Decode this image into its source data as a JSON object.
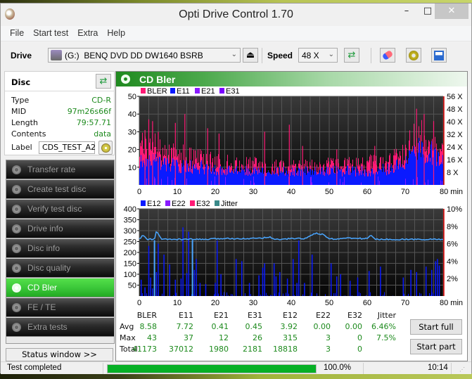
{
  "window": {
    "title": "Opti Drive Control 1.70",
    "minimize_glyph": "–",
    "maximize_glyph": "□",
    "close_glyph": "✕"
  },
  "menu": [
    "File",
    "Start test",
    "Extra",
    "Help"
  ],
  "toolbar": {
    "drive_label": "Drive",
    "drive_value": "(G:)  BENQ DVD DD DW1640 BSRB",
    "eject_glyph": "⏏",
    "speed_label": "Speed",
    "speed_value": "48 X",
    "chevron_glyph": "⌵"
  },
  "disc": {
    "title": "Disc",
    "fields": [
      {
        "key": "Type",
        "value": "CD-R"
      },
      {
        "key": "MID",
        "value": "97m26s66f"
      },
      {
        "key": "Length",
        "value": "79:57.71"
      },
      {
        "key": "Contents",
        "value": "data"
      }
    ],
    "label_key": "Label",
    "label_value": "CDS_TEST_A2"
  },
  "nav": [
    {
      "label": "Transfer rate",
      "active": false
    },
    {
      "label": "Create test disc",
      "active": false
    },
    {
      "label": "Verify test disc",
      "active": false
    },
    {
      "label": "Drive info",
      "active": false
    },
    {
      "label": "Disc info",
      "active": false
    },
    {
      "label": "Disc quality",
      "active": false
    },
    {
      "label": "CD Bler",
      "active": true
    },
    {
      "label": "FE / TE",
      "active": false
    },
    {
      "label": "Extra tests",
      "active": false
    }
  ],
  "status_window_label": "Status window >>",
  "panel_title": "CD Bler",
  "colors": {
    "bler": "#ff1a75",
    "e11": "#0a1aff",
    "e21": "#8a1aff",
    "e31": "#7a00ff",
    "e12": "#0a1aff",
    "e22": "#8a1aff",
    "e32": "#ff1a75",
    "jitter": "#3a8a8a",
    "jitter_line": "#4aa6ff",
    "accent_green": "#3cc83a",
    "value_green": "#1d8a1d",
    "progress_green": "#06b025"
  },
  "chart_data": [
    {
      "type": "bar",
      "title": "BLER / E11 / E21 / E31",
      "legend": [
        "BLER",
        "E11",
        "E21",
        "E31"
      ],
      "legend_position": "top-left",
      "xlabel": "min",
      "x_range": [
        0,
        80
      ],
      "x_ticks": [
        0,
        10,
        20,
        30,
        40,
        50,
        60,
        70,
        80
      ],
      "x_tick_labels": [
        "0",
        "10",
        "20",
        "30",
        "40",
        "50",
        "60",
        "70",
        "80 min"
      ],
      "ylim": [
        0,
        50
      ],
      "y_ticks": [
        10,
        20,
        30,
        40,
        50
      ],
      "y2_tick_labels": [
        "8 X",
        "16 X",
        "24 X",
        "32 X",
        "40 X",
        "48 X",
        "56 X"
      ],
      "y2_range": [
        0,
        56
      ],
      "grid": true,
      "profile": {
        "x": [
          0,
          2,
          4,
          6,
          8,
          10,
          12,
          14,
          16,
          18,
          20,
          22,
          24,
          26,
          28,
          30,
          32,
          34,
          36,
          38,
          40,
          42,
          44,
          46,
          48,
          50,
          52,
          54,
          56,
          58,
          60,
          62,
          64,
          66,
          68,
          70,
          72,
          74,
          76,
          78,
          80
        ],
        "bler_typ": [
          20,
          22,
          23,
          18,
          17,
          16,
          17,
          14,
          15,
          14,
          13,
          12,
          12,
          11,
          11,
          11,
          11,
          11,
          10,
          10,
          10,
          10,
          10,
          10,
          11,
          11,
          11,
          11,
          11,
          11,
          12,
          12,
          12,
          13,
          15,
          18,
          24,
          26,
          24,
          22,
          20
        ],
        "bler_peaks": [
          [
            1.5,
            31
          ],
          [
            2.5,
            37
          ],
          [
            3.5,
            36
          ],
          [
            5,
            30
          ],
          [
            9.5,
            35
          ],
          [
            12,
            40
          ],
          [
            18,
            32
          ],
          [
            21,
            29
          ],
          [
            33,
            30
          ],
          [
            39.5,
            34
          ],
          [
            43,
            22
          ],
          [
            52,
            20
          ],
          [
            62,
            22
          ],
          [
            73,
            43
          ],
          [
            75,
            40
          ],
          [
            77.5,
            36
          ]
        ],
        "e11_typ": [
          13,
          14,
          14,
          12,
          11,
          11,
          11,
          10,
          10,
          10,
          9,
          9,
          9,
          8,
          8,
          8,
          8,
          8,
          8,
          8,
          8,
          7,
          8,
          8,
          8,
          8,
          8,
          8,
          8,
          8,
          8,
          8,
          9,
          9,
          11,
          14,
          18,
          20,
          19,
          17,
          15
        ]
      }
    },
    {
      "type": "bar",
      "title": "E12 / E22 / E32 / Jitter",
      "legend": [
        "E12",
        "E22",
        "E32",
        "Jitter"
      ],
      "legend_position": "top-left",
      "xlabel": "min",
      "x_range": [
        0,
        80
      ],
      "x_ticks": [
        0,
        10,
        20,
        30,
        40,
        50,
        60,
        70,
        80
      ],
      "x_tick_labels": [
        "0",
        "10",
        "20",
        "30",
        "40",
        "50",
        "60",
        "70",
        "80 min"
      ],
      "ylim": [
        0,
        400
      ],
      "y_ticks": [
        50,
        100,
        150,
        200,
        250,
        300,
        350,
        400
      ],
      "y2_tick_labels": [
        "2%",
        "4%",
        "6%",
        "8%",
        "10%"
      ],
      "y2_range": [
        0,
        10
      ],
      "grid": true,
      "e12_spikes": [
        [
          0.5,
          75
        ],
        [
          1.5,
          40
        ],
        [
          2.5,
          230
        ],
        [
          3,
          85
        ],
        [
          3.5,
          35
        ],
        [
          4,
          165
        ],
        [
          4.5,
          110
        ],
        [
          5,
          240
        ],
        [
          6.5,
          190
        ],
        [
          8,
          145
        ],
        [
          9.5,
          75
        ],
        [
          11,
          80
        ],
        [
          11.5,
          315
        ],
        [
          12.5,
          105
        ],
        [
          13,
          295
        ],
        [
          14.5,
          120
        ],
        [
          15,
          170
        ],
        [
          16,
          60
        ],
        [
          17.5,
          55
        ],
        [
          20,
          60
        ],
        [
          20.5,
          255
        ],
        [
          21.5,
          100
        ],
        [
          25.5,
          170
        ],
        [
          27,
          160
        ],
        [
          29,
          60
        ],
        [
          31.5,
          95
        ],
        [
          32.5,
          130
        ],
        [
          33,
          150
        ],
        [
          35.5,
          150
        ],
        [
          36,
          90
        ],
        [
          37,
          110
        ],
        [
          39,
          80
        ],
        [
          40.5,
          170
        ],
        [
          41.5,
          60
        ],
        [
          42,
          255
        ],
        [
          43.5,
          60
        ],
        [
          45.5,
          190
        ],
        [
          50.5,
          150
        ],
        [
          52,
          90
        ],
        [
          53,
          100
        ],
        [
          55.5,
          70
        ],
        [
          57.5,
          85
        ],
        [
          60.5,
          115
        ],
        [
          63.5,
          135
        ],
        [
          69.5,
          85
        ],
        [
          71.5,
          120
        ],
        [
          73,
          110
        ],
        [
          75.5,
          135
        ],
        [
          77,
          120
        ],
        [
          78,
          160
        ],
        [
          78.5,
          170
        ],
        [
          79,
          140
        ]
      ],
      "jitter_pct": {
        "x": [
          0,
          1,
          2,
          4,
          4.5,
          6,
          10,
          14,
          18,
          22,
          26,
          30,
          33,
          34,
          36,
          38,
          40,
          42,
          44,
          46,
          48,
          50,
          52,
          54,
          56,
          58,
          60,
          61,
          62,
          64,
          66,
          70,
          74,
          78,
          80
        ],
        "y": [
          6.5,
          7.0,
          6.5,
          6.5,
          7.4,
          6.5,
          6.5,
          6.5,
          6.5,
          6.6,
          6.6,
          6.6,
          6.7,
          6.8,
          6.5,
          6.5,
          6.6,
          6.6,
          6.6,
          7.2,
          7.1,
          6.6,
          6.5,
          6.7,
          6.6,
          6.6,
          6.6,
          7.0,
          6.5,
          6.5,
          6.5,
          6.5,
          6.5,
          6.5,
          6.5
        ]
      },
      "jitter_spikes_markers": [
        4,
        14
      ]
    },
    {
      "type": "table",
      "columns": [
        "",
        "BLER",
        "E11",
        "E21",
        "E31",
        "E12",
        "E22",
        "E32",
        "Jitter"
      ],
      "rows": [
        [
          "Avg",
          "8.58",
          "7.72",
          "0.41",
          "0.45",
          "3.92",
          "0.00",
          "0.00",
          "6.46%"
        ],
        [
          "Max",
          "43",
          "37",
          "12",
          "26",
          "315",
          "3",
          "0",
          "7.5%"
        ],
        [
          "Total",
          "41173",
          "37012",
          "1980",
          "2181",
          "18818",
          "3",
          "0",
          ""
        ]
      ]
    }
  ],
  "buttons": {
    "start_full": "Start full",
    "start_part": "Start part"
  },
  "statusbar": {
    "text": "Test completed",
    "progress": 100.0,
    "progress_label": "100.0%",
    "time": "10:14"
  }
}
